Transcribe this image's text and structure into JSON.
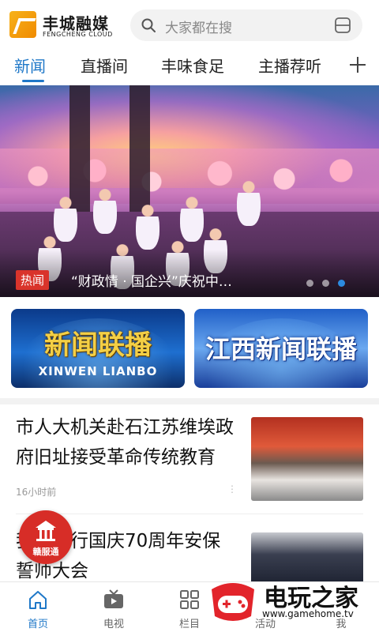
{
  "header": {
    "logo_cn": "丰城融媒",
    "logo_en": "FENGCHENG CLOUD",
    "search_placeholder": "大家都在搜",
    "icons": [
      "search-icon",
      "scan-icon"
    ]
  },
  "tabs": [
    {
      "label": "新闻",
      "active": true
    },
    {
      "label": "直播间",
      "active": false
    },
    {
      "label": "丰味食足",
      "active": false
    },
    {
      "label": "主播荐听",
      "active": false
    }
  ],
  "banner": {
    "badge": "热闻",
    "title": "“财政情 · 国企兴”庆祝中…",
    "slide_count": 3,
    "active_slide": 3
  },
  "programs": [
    {
      "title": "新闻联播",
      "subtitle": "XINWEN LIANBO"
    },
    {
      "title": "江西新闻联播",
      "subtitle": ""
    }
  ],
  "news": [
    {
      "title": "市人大机关赴石江苏维埃政府旧址接受革命传统教育",
      "time": "16小时前",
      "more": "⋮"
    },
    {
      "title": "我市举行国庆70周年安保誓师大会",
      "time": "",
      "more": ""
    }
  ],
  "float_badge": {
    "label": "赣服通"
  },
  "bottom_nav": [
    {
      "label": "首页",
      "icon": "home-icon",
      "active": true
    },
    {
      "label": "电视",
      "icon": "tv-icon",
      "active": false
    },
    {
      "label": "栏目",
      "icon": "grid-icon",
      "active": false
    },
    {
      "label": "活动",
      "icon": "activity-icon",
      "active": false
    },
    {
      "label": "我",
      "icon": "user-icon",
      "active": false
    }
  ],
  "watermark": {
    "cn": "电玩之家",
    "url": "www.gamehome.tv"
  },
  "colors": {
    "accent": "#1f78c8",
    "hot": "#d9342b",
    "badge": "#d72d27"
  }
}
